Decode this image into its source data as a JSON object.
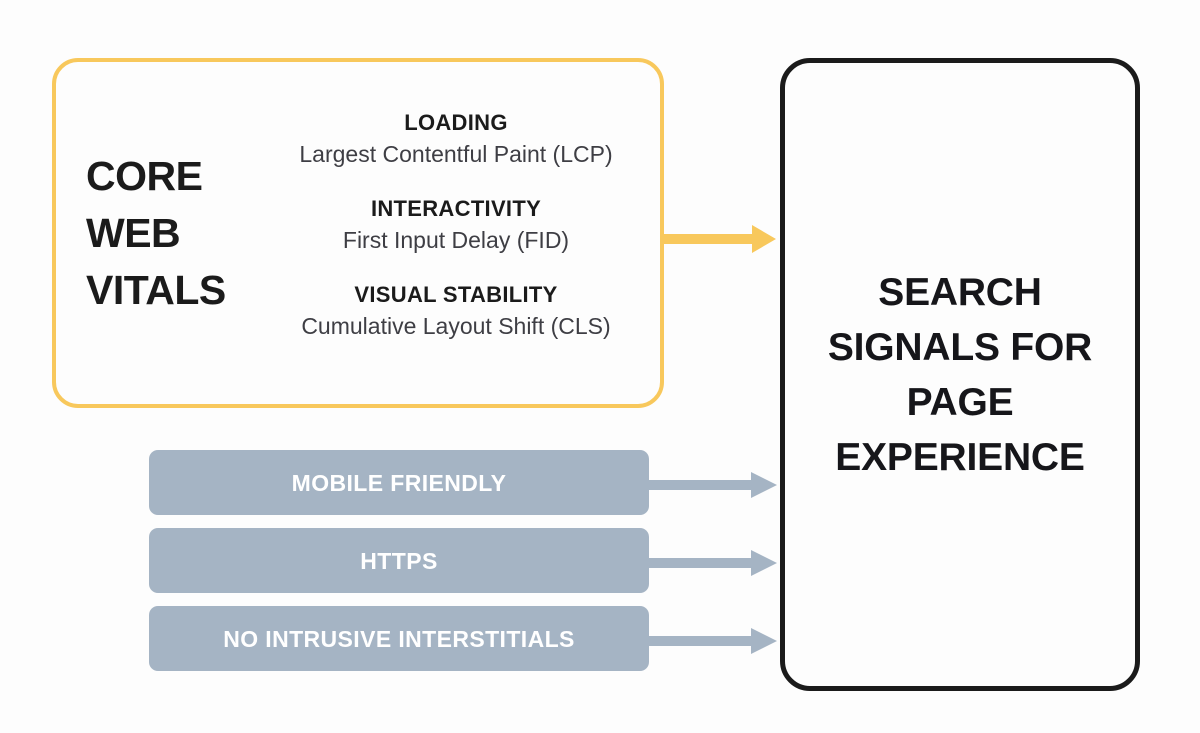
{
  "diagram": {
    "background_color": "#fdfdfd",
    "core_web_vitals": {
      "title": "CORE\nWEB\nVITALS",
      "border_color": "#f8c85c",
      "metrics": [
        {
          "heading": "LOADING",
          "subtitle": "Largest Contentful Paint (LCP)"
        },
        {
          "heading": "INTERACTIVITY",
          "subtitle": "First Input Delay (FID)"
        },
        {
          "heading": "VISUAL STABILITY",
          "subtitle": "Cumulative Layout Shift (CLS)"
        }
      ]
    },
    "signal_bars": {
      "fill_color": "#a5b4c4",
      "text_color": "#ffffff",
      "items": [
        {
          "label": "MOBILE FRIENDLY"
        },
        {
          "label": "HTTPS"
        },
        {
          "label": "NO INTRUSIVE INTERSTITIALS"
        }
      ]
    },
    "arrows": {
      "yellow": {
        "icon": "arrow-right-icon",
        "color": "#f8c85c"
      },
      "grey": {
        "icon": "arrow-right-icon",
        "color": "#a5b4c4"
      }
    },
    "result_panel": {
      "title": "SEARCH\nSIGNALS FOR\nPAGE\nEXPERIENCE",
      "border_color": "#1b1b1b",
      "text_color": "#16161a"
    }
  }
}
